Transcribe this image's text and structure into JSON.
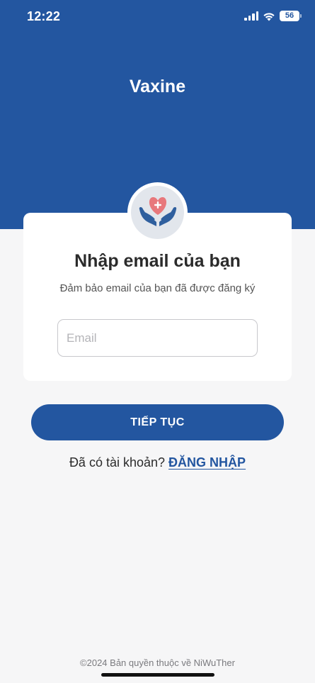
{
  "status_bar": {
    "time": "12:22",
    "battery": "56"
  },
  "header": {
    "app_title": "Vaxine"
  },
  "card": {
    "title": "Nhập email của bạn",
    "subtitle": "Đảm bảo email của bạn đã được đăng ký",
    "email_placeholder": "Email",
    "email_value": ""
  },
  "actions": {
    "continue_label": "TIẾP TỤC",
    "login_prompt": "Đã có tài khoản?",
    "login_link": "ĐĂNG NHẬP"
  },
  "footer": {
    "copyright": "©2024 Bản quyền thuộc về NiWuTher"
  },
  "colors": {
    "primary": "#2356a0",
    "background": "#f6f6f7",
    "heart": "#e8787c"
  },
  "icons": {
    "logo": "hands-holding-heart-icon"
  }
}
